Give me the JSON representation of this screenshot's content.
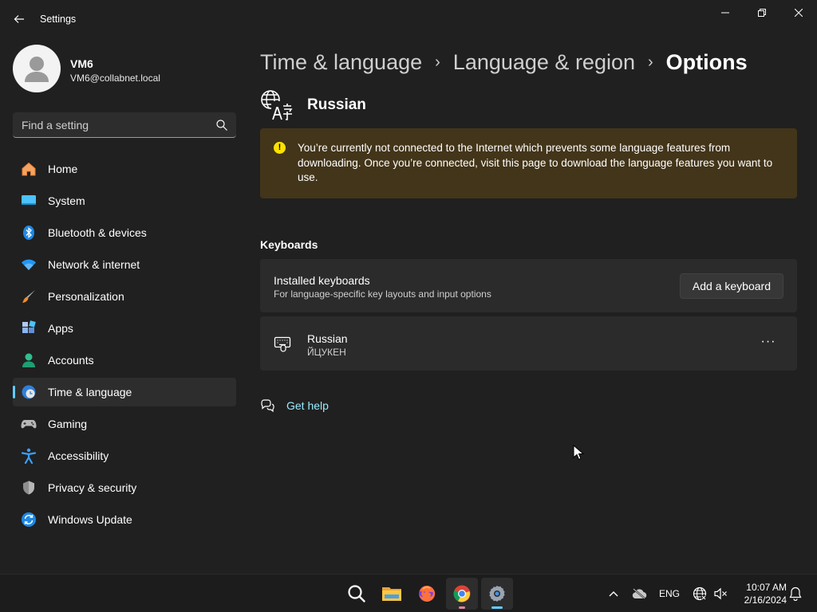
{
  "window": {
    "title": "Settings"
  },
  "profile": {
    "name": "VM6",
    "email": "VM6@collabnet.local"
  },
  "search": {
    "placeholder": "Find a setting",
    "value": ""
  },
  "sidebar": {
    "items": [
      {
        "label": "Home",
        "icon": "home-icon"
      },
      {
        "label": "System",
        "icon": "system-icon"
      },
      {
        "label": "Bluetooth & devices",
        "icon": "bluetooth-icon"
      },
      {
        "label": "Network & internet",
        "icon": "wifi-icon"
      },
      {
        "label": "Personalization",
        "icon": "brush-icon"
      },
      {
        "label": "Apps",
        "icon": "apps-icon"
      },
      {
        "label": "Accounts",
        "icon": "accounts-icon"
      },
      {
        "label": "Time & language",
        "icon": "time-language-icon",
        "active": true
      },
      {
        "label": "Gaming",
        "icon": "gamepad-icon"
      },
      {
        "label": "Accessibility",
        "icon": "accessibility-icon"
      },
      {
        "label": "Privacy & security",
        "icon": "shield-icon"
      },
      {
        "label": "Windows Update",
        "icon": "windows-update-icon"
      }
    ]
  },
  "breadcrumb": {
    "items": [
      "Time & language",
      "Language & region",
      "Options"
    ],
    "separator": "›"
  },
  "language": {
    "name": "Russian"
  },
  "warning": {
    "text": "You’re currently not connected to the Internet which prevents some language features from downloading. Once you’re connected, visit this page to download the language features you want to use."
  },
  "keyboards": {
    "section_title": "Keyboards",
    "installed_title": "Installed keyboards",
    "installed_subtitle": "For language-specific key layouts and input options",
    "add_button": "Add a keyboard",
    "items": [
      {
        "name": "Russian",
        "layout": "ЙЦУКЕН"
      }
    ],
    "more_label": "···"
  },
  "help": {
    "label": "Get help"
  },
  "taskbar": {
    "apps": [
      "search-icon",
      "file-explorer-icon",
      "firefox-icon",
      "chrome-icon",
      "settings-icon"
    ],
    "tray": {
      "language": "ENG",
      "time": "10:07 AM",
      "date": "2/16/2024"
    }
  },
  "colors": {
    "background": "#202020",
    "accent": "#60cdff",
    "warning_bg": "#433519",
    "link": "#99ebff"
  }
}
